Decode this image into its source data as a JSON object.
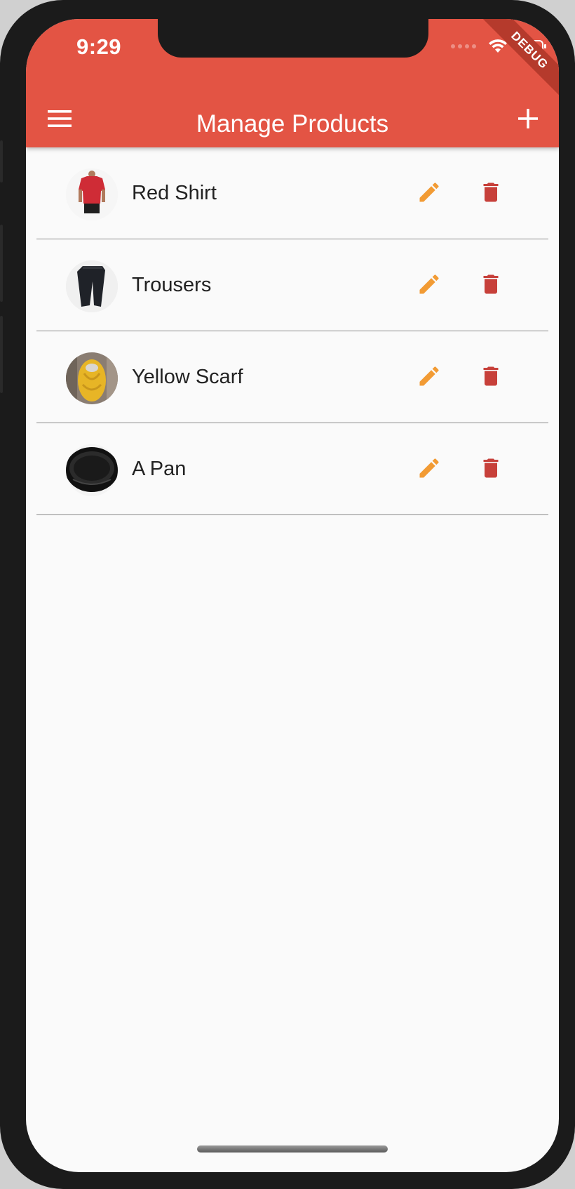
{
  "status_bar": {
    "time": "9:29",
    "battery_level": 0.8
  },
  "debug_banner": {
    "label": "DEBUG"
  },
  "app_bar": {
    "title": "Manage Products",
    "menu_icon": "hamburger-menu-icon",
    "add_icon": "plus-icon",
    "color": "#e35444"
  },
  "products": [
    {
      "title": "Red Shirt",
      "image_icon": "red-shirt-thumbnail",
      "edit_icon": "pencil-icon",
      "delete_icon": "trash-icon"
    },
    {
      "title": "Trousers",
      "image_icon": "trousers-thumbnail",
      "edit_icon": "pencil-icon",
      "delete_icon": "trash-icon"
    },
    {
      "title": "Yellow Scarf",
      "image_icon": "yellow-scarf-thumbnail",
      "edit_icon": "pencil-icon",
      "delete_icon": "trash-icon"
    },
    {
      "title": "A Pan",
      "image_icon": "pan-thumbnail",
      "edit_icon": "pencil-icon",
      "delete_icon": "trash-icon"
    }
  ],
  "colors": {
    "primary": "#e35444",
    "edit": "#f29b34",
    "delete": "#c7403a",
    "background": "#fafafa",
    "divider": "#8a8a8a",
    "text": "#222222"
  }
}
